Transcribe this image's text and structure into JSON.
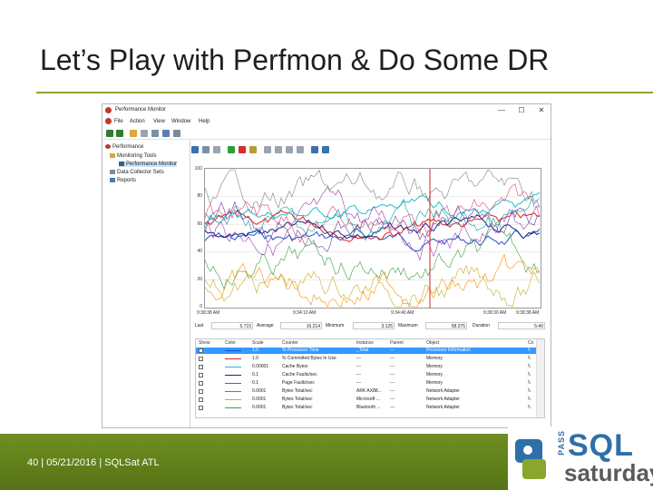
{
  "slide": {
    "title": "Let’s Play with Perfmon & Do Some DR",
    "footer": "40  |   05/21/2016  |  SQLSat ATL",
    "logo": {
      "pass": "PASS",
      "sql": "SQL",
      "saturday": "saturday"
    }
  },
  "window": {
    "title": "Performance Monitor",
    "controls": [
      "—",
      "☐",
      "✕"
    ],
    "menu": [
      "File",
      "Action",
      "View",
      "Window",
      "Help"
    ],
    "tree": [
      {
        "label": "Performance"
      },
      {
        "label": "Monitoring Tools"
      },
      {
        "label": "Performance Monitor"
      },
      {
        "label": "Data Collector Sets"
      },
      {
        "label": "Reports"
      }
    ],
    "graph": {
      "y_ticks": [
        "100",
        "80",
        "60",
        "40",
        "20",
        "0"
      ],
      "x_ticks": [
        "9:38:38 AM",
        "9:34:10 AM",
        "9:34:40 AM",
        "9:38:30 AM",
        "9:38:38 AM"
      ]
    },
    "stats": {
      "last_label": "Last",
      "last_value": "5.715",
      "average_label": "Average",
      "average_value": "16.214",
      "minimum_label": "Minimum",
      "minimum_value": "3.125",
      "maximum_label": "Maximum",
      "maximum_value": "58.375",
      "duration_label": "Duration",
      "duration_value": "5:40"
    },
    "table": {
      "headers": [
        "Show",
        "Color",
        "Scale",
        "Counter",
        "Instance",
        "Parent",
        "Object",
        "Co"
      ],
      "rows": [
        {
          "scale": "1.0",
          "counter": "% Processor Time",
          "instance": "_Total",
          "parent": "---",
          "object": "Processor Information",
          "co": "\\\\",
          "color": "#1f4fd6"
        },
        {
          "scale": "1.0",
          "counter": "% Committed Bytes In Use",
          "instance": "---",
          "parent": "---",
          "object": "Memory",
          "co": "\\\\",
          "color": "#e02020"
        },
        {
          "scale": "0.00001",
          "counter": "Cache Bytes",
          "instance": "---",
          "parent": "---",
          "object": "Memory",
          "co": "\\\\",
          "color": "#20c0d0"
        },
        {
          "scale": "0.1",
          "counter": "Cache Faults/sec",
          "instance": "---",
          "parent": "---",
          "object": "Memory",
          "co": "\\\\",
          "color": "#1a237e"
        },
        {
          "scale": "0.1",
          "counter": "Page Faults/sec",
          "instance": "---",
          "parent": "---",
          "object": "Memory",
          "co": "\\\\",
          "color": "#9e3bb0"
        },
        {
          "scale": "0.0001",
          "counter": "Bytes Total/sec",
          "instance": "ARK AX88...",
          "parent": "---",
          "object": "Network Adapter",
          "co": "\\\\",
          "color": "#e0407a"
        },
        {
          "scale": "0.0001",
          "counter": "Bytes Total/sec",
          "instance": "Microsoft ...",
          "parent": "---",
          "object": "Network Adapter",
          "co": "\\\\",
          "color": "#c0b020"
        },
        {
          "scale": "0.0001",
          "counter": "Bytes Total/sec",
          "instance": "Bluetooth ...",
          "parent": "---",
          "object": "Network Adapter",
          "co": "\\\\",
          "color": "#3aa040"
        }
      ]
    }
  }
}
